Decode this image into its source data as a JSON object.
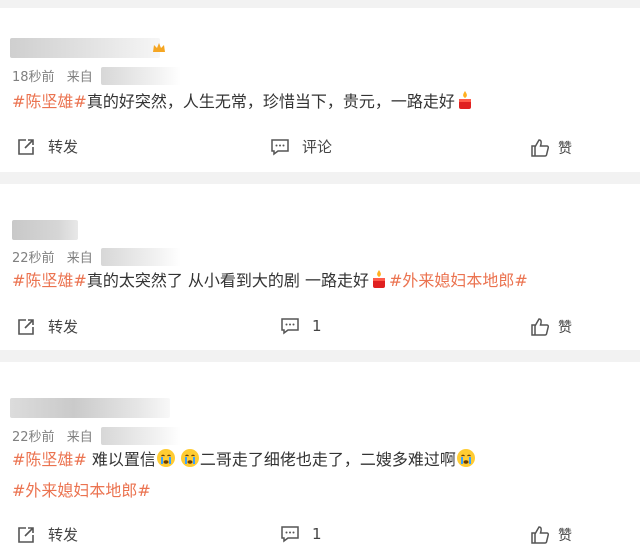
{
  "posts": [
    {
      "time": "18秒前",
      "from_label": "来自",
      "segments": [
        {
          "kind": "tag",
          "text": "#陈坚雄#"
        },
        {
          "kind": "text",
          "text": "真的好突然，人生无常，珍惜当下，贵元，一路走好"
        },
        {
          "kind": "emoji",
          "icon": "candle-icon"
        }
      ],
      "line2": [],
      "repost_label": "转发",
      "comment_label": "评论",
      "like_label": "赞"
    },
    {
      "time": "22秒前",
      "from_label": "来自",
      "segments": [
        {
          "kind": "tag",
          "text": "#陈坚雄#"
        },
        {
          "kind": "text",
          "text": "真的太突然了 从小看到大的剧 一路走好"
        },
        {
          "kind": "emoji",
          "icon": "candle-icon"
        },
        {
          "kind": "tag",
          "text": "#外来媳妇本地郎#"
        }
      ],
      "line2": [],
      "repost_label": "转发",
      "comment_label": "1",
      "like_label": "赞"
    },
    {
      "time": "22秒前",
      "from_label": "来自",
      "segments": [
        {
          "kind": "tag",
          "text": "#陈坚雄#"
        },
        {
          "kind": "text",
          "text": " 难以置信"
        },
        {
          "kind": "emoji",
          "icon": "crying-face-icon"
        },
        {
          "kind": "emoji",
          "icon": "crying-face-icon"
        },
        {
          "kind": "text",
          "text": "二哥走了细佬也走了，二嫂多难过啊"
        },
        {
          "kind": "emoji",
          "icon": "crying-face-icon"
        }
      ],
      "line2": [
        {
          "kind": "tag",
          "text": "#外来媳妇本地郎#"
        }
      ],
      "repost_label": "转发",
      "comment_label": "1",
      "like_label": "赞"
    }
  ],
  "colors": {
    "tag": "#eb7350",
    "text": "#333333",
    "meta": "#808080",
    "separator": "#f2f2f2"
  }
}
